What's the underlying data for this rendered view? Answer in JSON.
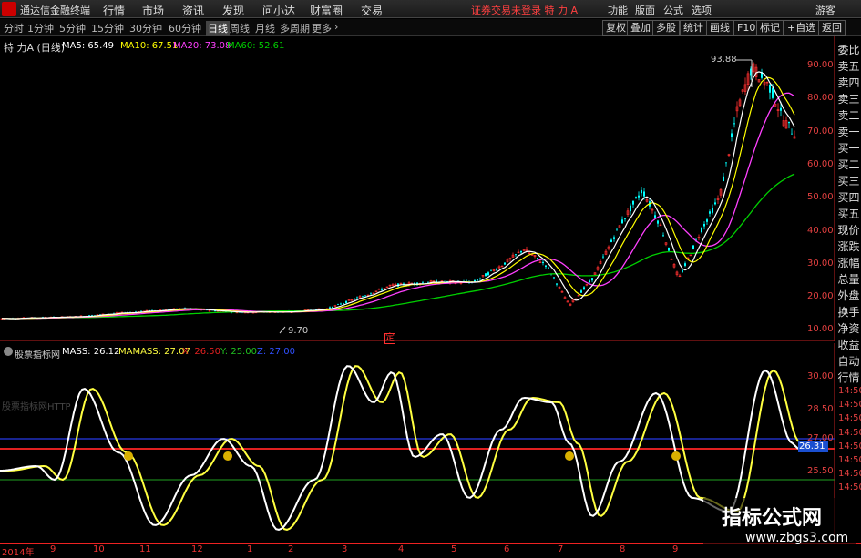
{
  "menubar": {
    "app_title": "通达信金融终端",
    "items": [
      "行情",
      "市场",
      "资讯",
      "发现",
      "问小达",
      "财富圈",
      "交易"
    ],
    "notice": "证券交易未登录  特 力 A",
    "right_items": [
      "功能",
      "版面",
      "公式",
      "选项"
    ],
    "guest": "游客"
  },
  "periods": [
    "分时",
    "1分钟",
    "5分钟",
    "15分钟",
    "30分钟",
    "60分钟",
    "日线",
    "周线",
    "月线",
    "多周期",
    "更多"
  ],
  "active_period": "日线",
  "tools": [
    "复权",
    "叠加",
    "多股",
    "统计",
    "画线",
    "F10",
    "标记",
    "+自选",
    "返回"
  ],
  "main_legend": {
    "title": "特 力A (日线)",
    "ma5": "MA5: 65.49",
    "ma10": "MA10: 67.51",
    "ma20": "MA20: 73.08",
    "ma60": "MA60: 52.61"
  },
  "colors": {
    "ma5": "#ffffff",
    "ma10": "#ffff00",
    "ma20": "#ff40ff",
    "ma60": "#00d000",
    "up": "#ff3030",
    "down": "#00ffff",
    "axis": "#e34040"
  },
  "high_label": "93.88",
  "low_label": "9.70",
  "marker": "定",
  "price_axis": [
    "90.00",
    "80.00",
    "70.00",
    "60.00",
    "50.00",
    "40.00",
    "30.00",
    "20.00",
    "10.00"
  ],
  "side_panel": [
    "委比",
    "卖五",
    "卖四",
    "卖三",
    "卖二",
    "卖一",
    "买一",
    "买二",
    "买三",
    "买四",
    "买五",
    "现价",
    "涨跌",
    "涨幅",
    "总量",
    "外盘",
    "换手",
    "净资",
    "收益",
    "自动",
    "行情"
  ],
  "sub_legend": {
    "name": "股票指标网",
    "mass": "MASS: 26.12",
    "mamass": "MAMASS: 27.07",
    "x": "X: 26.50",
    "y": "Y: 25.00",
    "z": "Z: 27.00"
  },
  "sub_watermark": "股票指标网HTTP",
  "sub_axis": [
    "30.00",
    "28.50",
    "27.00",
    "25.50"
  ],
  "sub_axis_times": [
    "14:50",
    "14:50",
    "14:50",
    "14:50",
    "14:50",
    "14:50",
    "14:50",
    "14:50"
  ],
  "current_value": "26.31",
  "dates": [
    "2014年",
    "9",
    "10",
    "11",
    "12",
    "1",
    "2",
    "3",
    "4",
    "5",
    "6",
    "7",
    "8",
    "9"
  ],
  "watermark": {
    "title": "指标公式网",
    "url": "www.zbgs3.com"
  }
}
